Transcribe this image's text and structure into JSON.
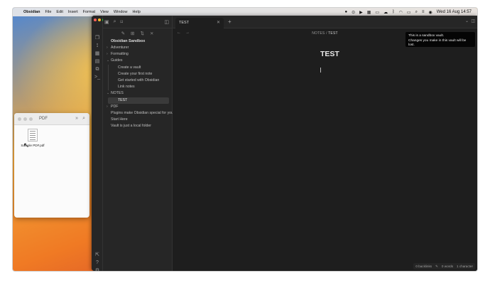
{
  "menubar": {
    "apple_icon": "apple-icon",
    "app_name": "Obsidian",
    "menus": [
      "File",
      "Edit",
      "Insert",
      "Format",
      "View",
      "Window",
      "Help"
    ],
    "clock": "Wed 16 Aug  14:57"
  },
  "finder": {
    "title": "PDF",
    "file_name": "Sample PDF.pdf"
  },
  "obsidian": {
    "traffic_colors": [
      "#ff5f57",
      "#febc2e",
      "#28c840"
    ],
    "vault_name": "Obsidian Sandbox",
    "tree": [
      {
        "label": "Adventurer",
        "kind": "folder",
        "open": false
      },
      {
        "label": "Formatting",
        "kind": "folder",
        "open": false
      },
      {
        "label": "Guides",
        "kind": "folder",
        "open": true
      },
      {
        "label": "Create a vault",
        "kind": "child"
      },
      {
        "label": "Create your first note",
        "kind": "child"
      },
      {
        "label": "Get started with Obsidian",
        "kind": "child"
      },
      {
        "label": "Link notes",
        "kind": "child"
      },
      {
        "label": "NOTES",
        "kind": "folder",
        "open": true
      },
      {
        "label": "TEST",
        "kind": "child",
        "active": true
      },
      {
        "label": "PDF",
        "kind": "folder",
        "open": false
      },
      {
        "label": "Plugins make Obsidian special for you",
        "kind": "file"
      },
      {
        "label": "Start Here",
        "kind": "file"
      },
      {
        "label": "Vault is just a local folder",
        "kind": "file"
      }
    ],
    "tab_title": "TEST",
    "breadcrumb_folder": "NOTES",
    "breadcrumb_sep": "/",
    "breadcrumb_note": "TEST",
    "note_title": "TEST",
    "tooltip_line1": "This is a sandbox vault.",
    "tooltip_line2": "Changes you make in this vault will be lost.",
    "status_backlinks": "0 backlinks",
    "status_words": "0 words",
    "status_chars": "1 character"
  }
}
